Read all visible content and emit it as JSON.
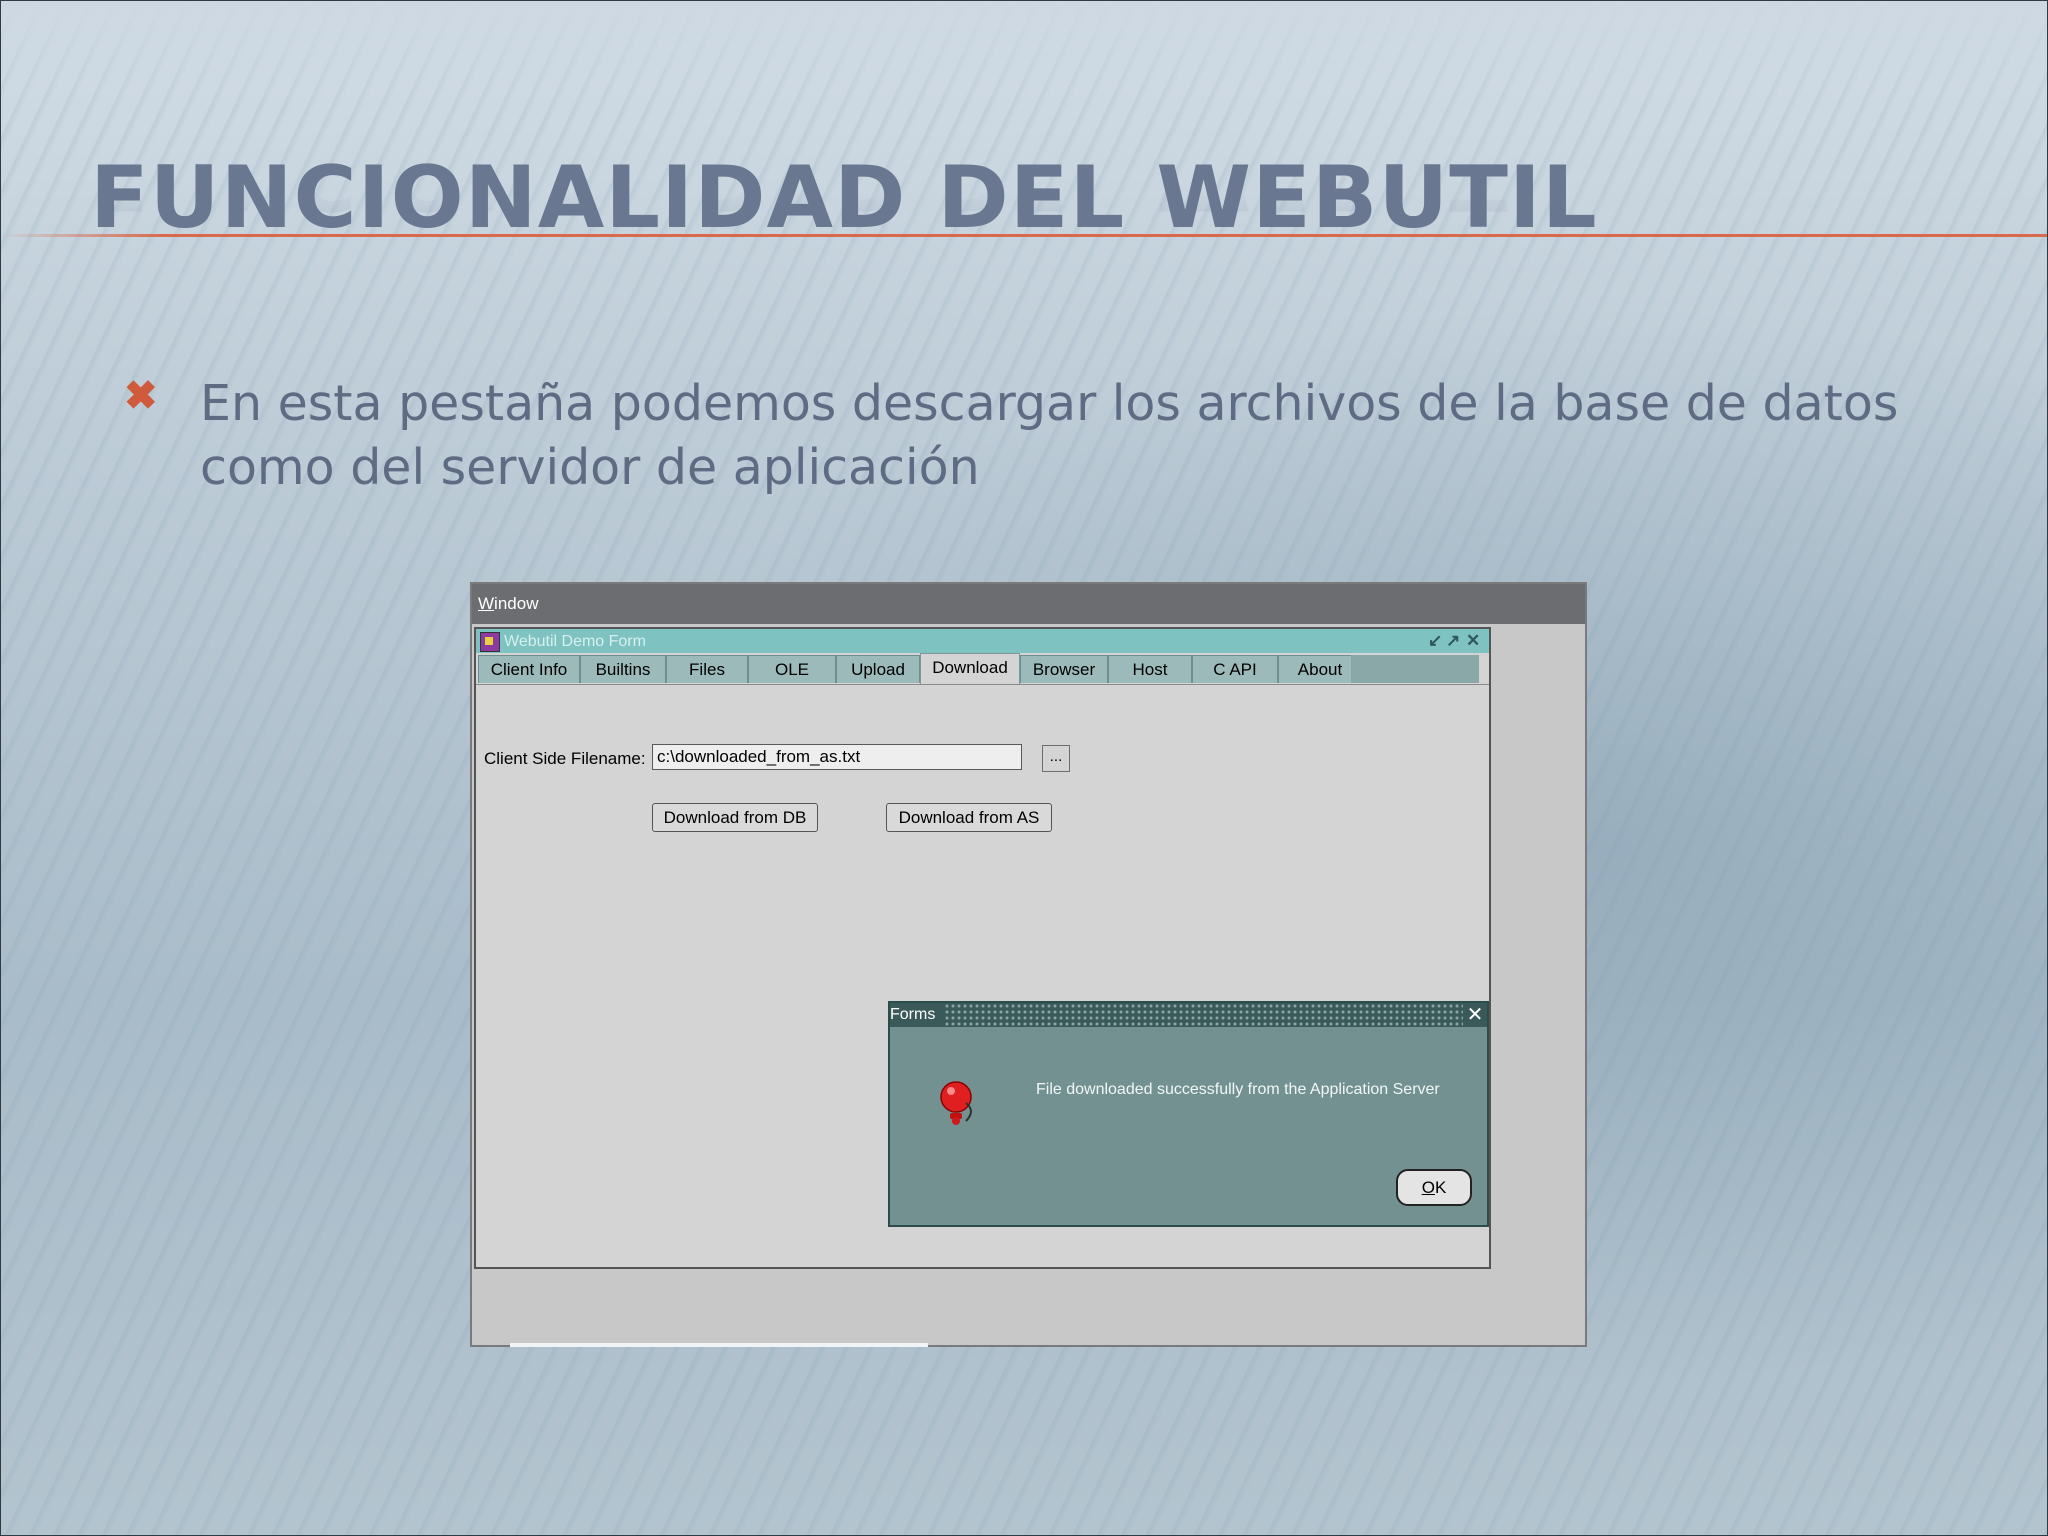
{
  "slide": {
    "title": "FUNCIONALIDAD DEL WEBUTIL",
    "bullet_mark": "✖",
    "bullet_text": "En esta pestaña podemos descargar los archivos de la base de datos como del servidor de aplicación"
  },
  "app": {
    "menu": {
      "window_label_first": "W",
      "window_label_rest": "indow"
    },
    "form": {
      "title": "Webutil Demo Form",
      "controls": {
        "minimize": "↙",
        "maximize": "↗",
        "close": "✕"
      },
      "tabs": [
        "Client Info",
        "Builtins",
        "Files",
        "OLE",
        "Upload",
        "Download",
        "Browser",
        "Host",
        "C API",
        "About"
      ],
      "active_tab": "Download",
      "client_filename_label": "Client Side Filename:",
      "client_filename_value": "c:\\downloaded_from_as.txt",
      "browse_label": "...",
      "download_db_label": "Download from DB",
      "download_as_label": "Download from AS"
    },
    "dialog": {
      "title": "Forms",
      "close": "✕",
      "message": "File downloaded successfully from the Application Server",
      "ok_first": "O",
      "ok_rest": "K"
    }
  },
  "colors": {
    "title": "#6a7790",
    "accent_rule": "#d86a4c",
    "bullet": "#d05a3c",
    "form_titlebar": "#7fc2c2",
    "dialog_bg": "#739191"
  }
}
